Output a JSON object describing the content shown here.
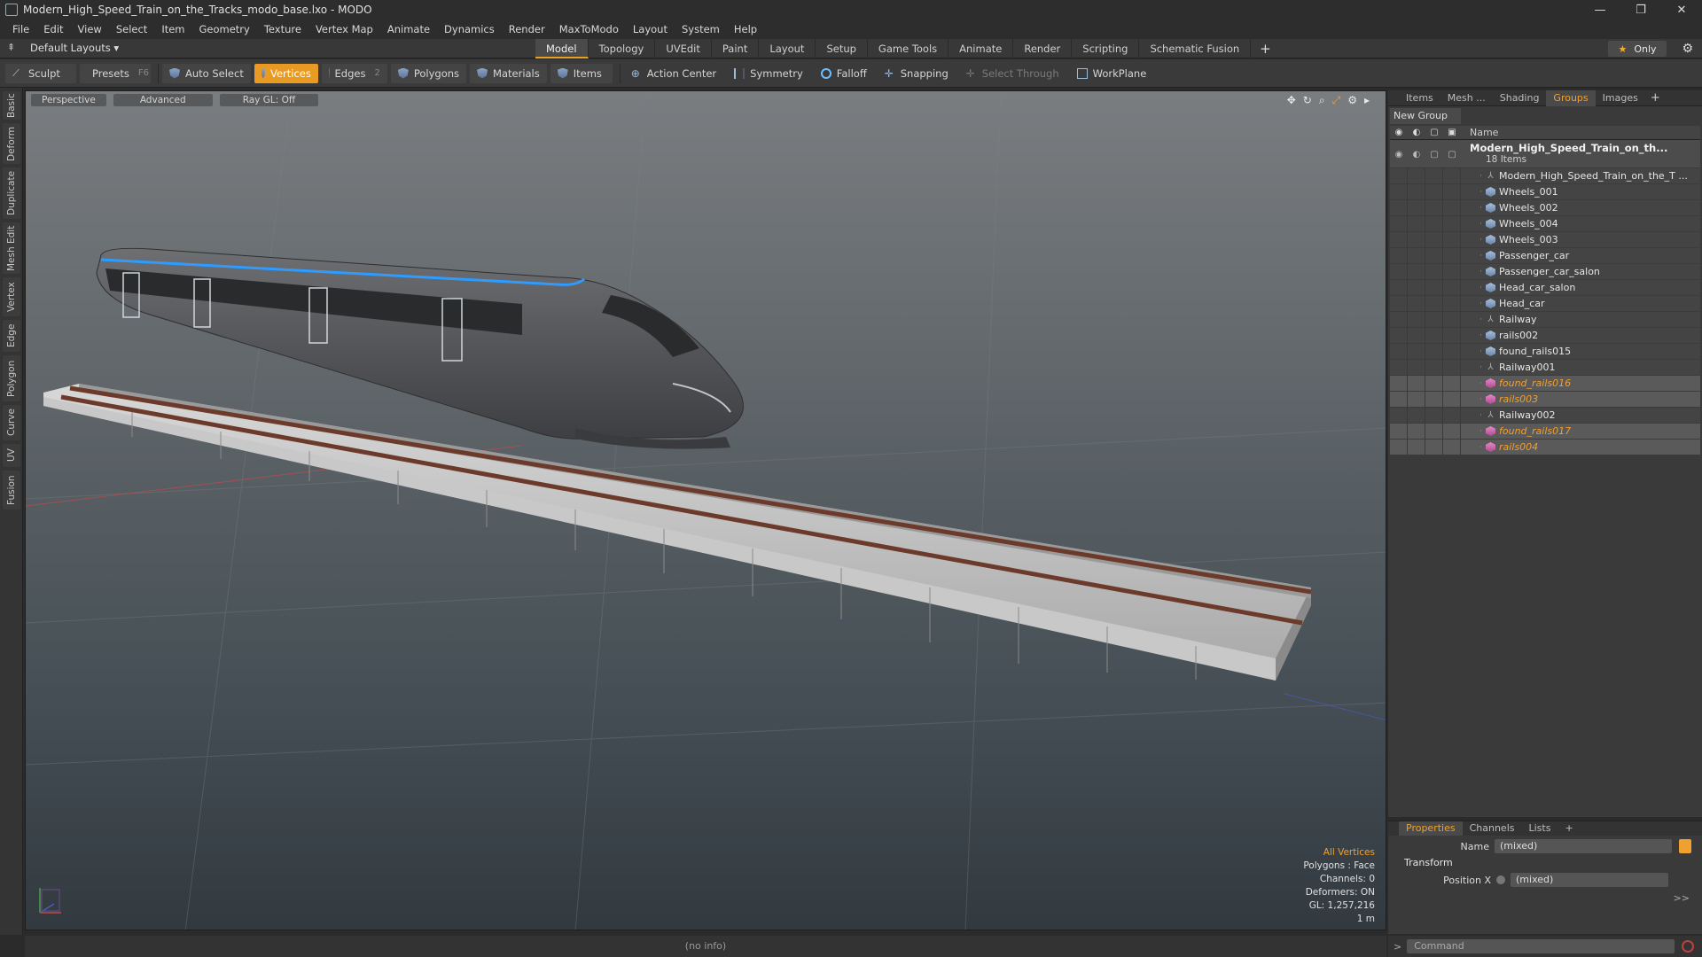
{
  "window": {
    "title": "Modern_High_Speed_Train_on_the_Tracks_modo_base.lxo - MODO",
    "controls": [
      "—",
      "❐",
      "✕"
    ]
  },
  "menu": [
    "File",
    "Edit",
    "View",
    "Select",
    "Item",
    "Geometry",
    "Texture",
    "Vertex Map",
    "Animate",
    "Dynamics",
    "Render",
    "MaxToModo",
    "Layout",
    "System",
    "Help"
  ],
  "layout_bar": {
    "layouts_label": "Default Layouts ▾",
    "tabs": [
      "Model",
      "Topology",
      "UVEdit",
      "Paint",
      "Layout",
      "Setup",
      "Game Tools",
      "Animate",
      "Render",
      "Scripting",
      "Schematic Fusion"
    ],
    "active_tab": "Model",
    "add_tab": "+",
    "only_label": "Only"
  },
  "toolbar": {
    "sculpt": "Sculpt",
    "presets": "Presets",
    "presets_key": "F6",
    "auto_select": "Auto Select",
    "vertices": "Vertices",
    "edges": "Edges",
    "edges_count": "2",
    "polygons": "Polygons",
    "materials": "Materials",
    "items": "Items",
    "action_center": "Action Center",
    "symmetry": "Symmetry",
    "falloff": "Falloff",
    "snapping": "Snapping",
    "select_through": "Select Through",
    "workplane": "WorkPlane"
  },
  "left_tabs": [
    "Basic",
    "Deform",
    "Duplicate",
    "Mesh Edit",
    "Vertex",
    "Edge",
    "Polygon",
    "Curve",
    "UV",
    "Fusion"
  ],
  "viewport": {
    "view_mode": "Perspective",
    "shading": "Advanced",
    "raygl": "Ray GL: Off",
    "info": {
      "selection": "All Vertices",
      "polygons": "Polygons : Face",
      "channels": "Channels: 0",
      "deformers": "Deformers: ON",
      "gl": "GL: 1,257,216",
      "scale": "1 m"
    }
  },
  "right_panel": {
    "tabs": [
      "Items",
      "Mesh ...",
      "Shading",
      "Groups",
      "Images"
    ],
    "active_tab": "Groups",
    "new_group": "New Group",
    "column_name": "Name",
    "group": {
      "name": "Modern_High_Speed_Train_on_th...",
      "count": "18 Items"
    },
    "items": [
      {
        "label": "Modern_High_Speed_Train_on_the_T ...",
        "icon": "locator-icon",
        "selected": false
      },
      {
        "label": "Wheels_001",
        "icon": "mesh-icon",
        "selected": false
      },
      {
        "label": "Wheels_002",
        "icon": "mesh-icon",
        "selected": false
      },
      {
        "label": "Wheels_004",
        "icon": "mesh-icon",
        "selected": false
      },
      {
        "label": "Wheels_003",
        "icon": "mesh-icon",
        "selected": false
      },
      {
        "label": "Passenger_car",
        "icon": "mesh-icon",
        "selected": false
      },
      {
        "label": "Passenger_car_salon",
        "icon": "mesh-icon",
        "selected": false
      },
      {
        "label": "Head_car_salon",
        "icon": "mesh-icon",
        "selected": false
      },
      {
        "label": "Head_car",
        "icon": "mesh-icon",
        "selected": false
      },
      {
        "label": "Railway",
        "icon": "locator-icon",
        "selected": false
      },
      {
        "label": "rails002",
        "icon": "mesh-icon",
        "selected": false
      },
      {
        "label": "found_rails015",
        "icon": "mesh-icon",
        "selected": false
      },
      {
        "label": "Railway001",
        "icon": "locator-icon",
        "selected": false
      },
      {
        "label": "found_rails016",
        "icon": "instance-icon",
        "selected": true
      },
      {
        "label": "rails003",
        "icon": "instance-icon",
        "selected": true
      },
      {
        "label": "Railway002",
        "icon": "locator-icon",
        "selected": false
      },
      {
        "label": "found_rails017",
        "icon": "instance-icon",
        "selected": true
      },
      {
        "label": "rails004",
        "icon": "instance-icon",
        "selected": true
      }
    ]
  },
  "properties": {
    "tabs": [
      "Properties",
      "Channels",
      "Lists"
    ],
    "active_tab": "Properties",
    "add": "+",
    "name_label": "Name",
    "name_value": "(mixed)",
    "transform_label": "Transform",
    "position_x_label": "Position X",
    "position_x_value": "(mixed)",
    "more": ">>"
  },
  "status": {
    "info": "(no info)",
    "command_prompt": ">",
    "command_placeholder": "Command"
  },
  "colors": {
    "accent": "#e89a22",
    "selected_text": "#f0a030",
    "train_stripe": "#2e9cff"
  }
}
